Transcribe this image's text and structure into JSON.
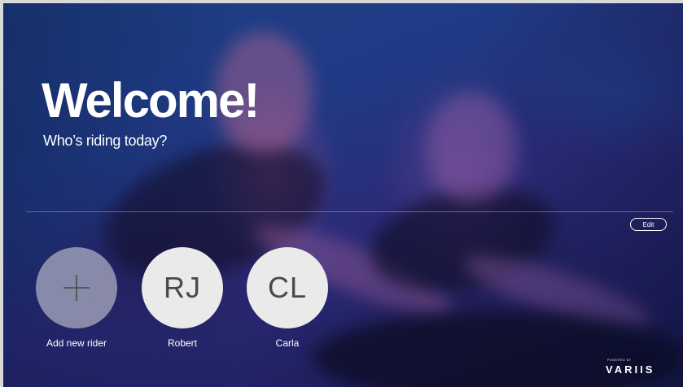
{
  "header": {
    "title": "Welcome!",
    "subtitle": "Who’s riding today?"
  },
  "actions": {
    "edit_label": "Edit"
  },
  "riders": [
    {
      "initials": "",
      "label": "Add new rider",
      "icon": "plus-icon"
    },
    {
      "initials": "RJ",
      "label": "Robert"
    },
    {
      "initials": "CL",
      "label": "Carla"
    }
  ],
  "brand": {
    "powered_by": "POWERED BY",
    "logo": "VARIIS"
  },
  "colors": {
    "text": "#ffffff",
    "avatar_fill": "#eaeaea",
    "avatar_text": "#4a4a4a",
    "background": "#203b86"
  }
}
